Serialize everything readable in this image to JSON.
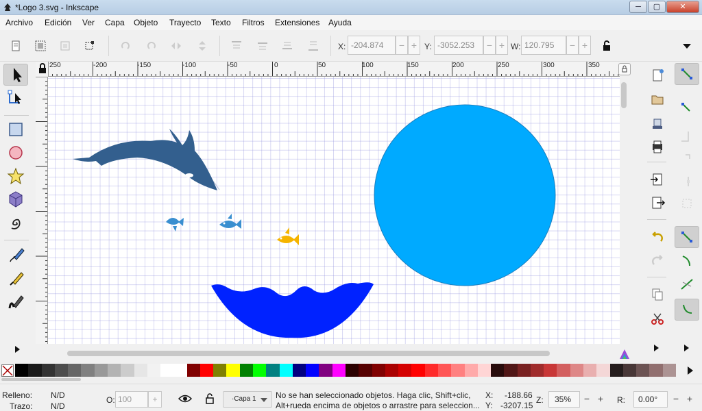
{
  "window": {
    "title": "*Logo 3.svg - Inkscape",
    "minimize": "─",
    "maximize": "▢",
    "close": "✕"
  },
  "menu": [
    "Archivo",
    "Edición",
    "Ver",
    "Capa",
    "Objeto",
    "Trayecto",
    "Texto",
    "Filtros",
    "Extensiones",
    "Ayuda"
  ],
  "toolbar": {
    "x_label": "X:",
    "x_value": "-204.874",
    "y_label": "Y:",
    "y_value": "-3052.253",
    "w_label": "W:",
    "w_value": "120.795",
    "spin_minus": "−",
    "spin_plus": "+"
  },
  "ruler": {
    "ticks": [
      "250",
      "-200",
      "-150",
      "-100",
      "-50",
      "0",
      "50",
      "100",
      "150",
      "200",
      "250",
      "300",
      "350"
    ]
  },
  "palette": {
    "colors": [
      "#000000",
      "#1a1a1a",
      "#333333",
      "#4d4d4d",
      "#666666",
      "#808080",
      "#999999",
      "#b3b3b3",
      "#cccccc",
      "#e6e6e6",
      "#f2f2f2",
      "#ffffff",
      "#ffffff",
      "#800000",
      "#ff0000",
      "#808000",
      "#ffff00",
      "#008000",
      "#00ff00",
      "#008080",
      "#00ffff",
      "#000080",
      "#0000ff",
      "#800080",
      "#ff00ff",
      "#2b0000",
      "#550000",
      "#800000",
      "#aa0000",
      "#d40000",
      "#ff0000",
      "#ff2a2a",
      "#ff5555",
      "#ff8080",
      "#ffaaaa",
      "#ffd5d5",
      "#280b0b",
      "#501616",
      "#782121",
      "#a02c2c",
      "#c83737",
      "#d35f5f",
      "#de8787",
      "#e9afaf",
      "#f4d7d7",
      "#241c1c",
      "#483737",
      "#6c5353",
      "#916f6f",
      "#ac9393"
    ]
  },
  "status": {
    "fill_label": "Relleno:",
    "fill_value": "N/D",
    "stroke_label": "Trazo:",
    "stroke_value": "N/D",
    "opacity_label": "O:",
    "opacity_value": "100",
    "layer": "·Capa 1",
    "message_line1": "No se han seleccionado objetos. Haga clic, Shift+clic,",
    "message_line2": "Alt+rueda encima de objetos o arrastre para seleccion...",
    "cursor_x_label": "X:",
    "cursor_x": "-188.66",
    "cursor_y_label": "Y:",
    "cursor_y": "-3207.15",
    "zoom_label": "Z:",
    "zoom_value": "35%",
    "rotate_label": "R:",
    "rotate_value": "0.00°"
  },
  "colors": {
    "whale": "#335f8e",
    "circle": "#00aaff",
    "circle_stroke": "#1a7fc0",
    "wave": "#0022ff",
    "fish_blue": "#3a8fd0",
    "fish_gold": "#f5b400"
  }
}
